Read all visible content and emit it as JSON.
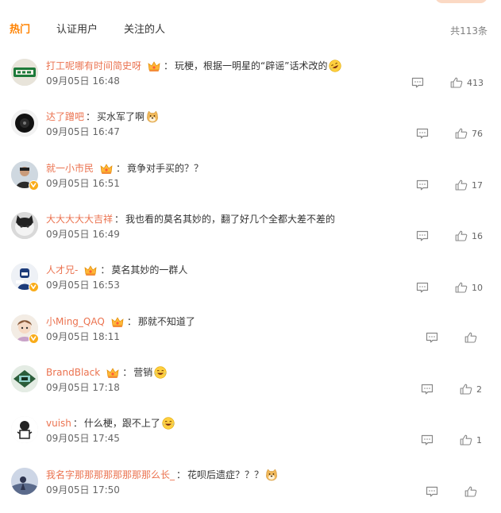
{
  "tabs": [
    {
      "label": "热门"
    },
    {
      "label": "认证用户"
    },
    {
      "label": "关注的人"
    }
  ],
  "total": "共113条",
  "colors": {
    "accent": "#ff8200",
    "username": "#eb7350",
    "badge": "#f9ac1a"
  },
  "comments": [
    {
      "user": "打工呢哪有时间简史呀",
      "text": "玩梗，根据一明星的“辟谣”话术改的",
      "emoji": "laugh-cry-sideways-emoji",
      "time": "09月05日 16:48",
      "likes": "413"
    },
    {
      "user": "达了蹭吧",
      "text": "买水军了啊",
      "emoji": "doge-emoji",
      "time": "09月05日 16:47",
      "likes": "76"
    },
    {
      "user": "就一小市民",
      "text": "竟争对手买的？？",
      "emoji": "",
      "time": "09月05日 16:51",
      "likes": "17"
    },
    {
      "user": "大大大大大吉祥",
      "text": "我也看的莫名其妙的，翻了好几个全都大差不差的",
      "emoji": "",
      "time": "09月05日 16:49",
      "likes": "16"
    },
    {
      "user": "人才兄-",
      "text": "莫名其妙的一群人",
      "emoji": "",
      "time": "09月05日 16:53",
      "likes": "10"
    },
    {
      "user": "小Ming_QAQ",
      "text": "那就不知道了",
      "emoji": "",
      "time": "09月05日 18:11",
      "likes": ""
    },
    {
      "user": "BrandBlack",
      "text": "营销",
      "emoji": "laugh-cry-emoji",
      "time": "09月05日 17:18",
      "likes": "2"
    },
    {
      "user": "vuish",
      "text": "什么梗，跟不上了",
      "emoji": "laugh-cry-emoji",
      "time": "09月05日 17:45",
      "likes": "1"
    },
    {
      "user": "我名字那那那那那那那那么长_",
      "text": "花呗后遗症？？？",
      "emoji": "doge-emoji",
      "time": "09月05日 17:50",
      "likes": ""
    }
  ]
}
